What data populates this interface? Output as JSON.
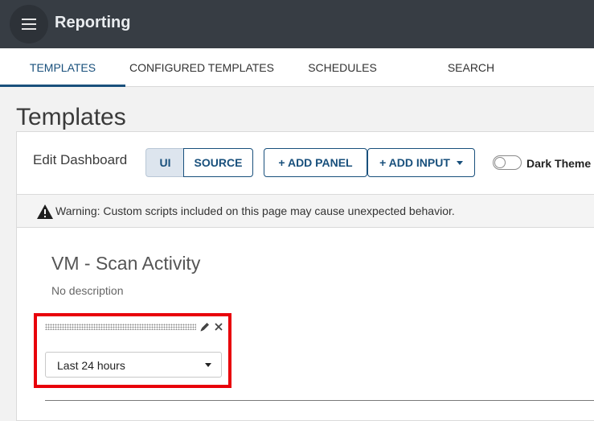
{
  "app": {
    "title": "Reporting",
    "menu_icon": "hamburger-menu-icon"
  },
  "tabs": [
    {
      "label": "TEMPLATES",
      "active": true
    },
    {
      "label": "CONFIGURED TEMPLATES",
      "active": false
    },
    {
      "label": "SCHEDULES",
      "active": false
    },
    {
      "label": "SEARCH",
      "active": false
    }
  ],
  "page": {
    "title": "Templates"
  },
  "toolbar": {
    "edit_label": "Edit Dashboard",
    "mode_ui": "UI",
    "mode_source": "SOURCE",
    "selected_mode": "UI",
    "add_panel": "+ ADD PANEL",
    "add_input": "+ ADD INPUT",
    "dark_theme_label": "Dark Theme",
    "dark_theme_on": false
  },
  "warning": {
    "text": "Warning: Custom scripts included on this page may cause unexpected behavior.",
    "icon": "warning-triangle-icon"
  },
  "dashboard": {
    "title": "VM - Scan Activity",
    "description": "No description"
  },
  "input_panel": {
    "selected_value": "Last 24 hours",
    "icons": [
      "drag-handle-icon",
      "edit-pencil-icon",
      "close-icon",
      "chevron-down-icon"
    ]
  },
  "colors": {
    "topbar": "#373d44",
    "accent": "#19507c",
    "highlight_border": "#e8000a"
  }
}
